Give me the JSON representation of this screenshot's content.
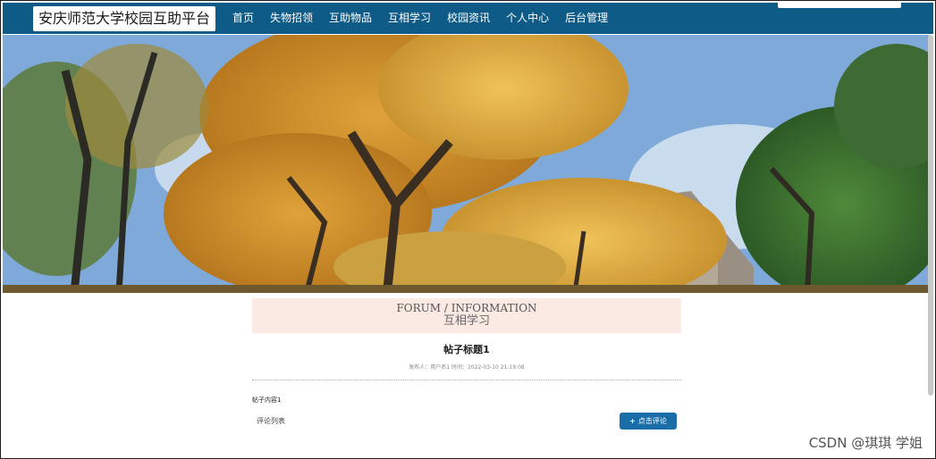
{
  "nav": {
    "brand": "安庆师范大学校园互助平台",
    "items": [
      {
        "label": "首页"
      },
      {
        "label": "失物招领"
      },
      {
        "label": "互助物品"
      },
      {
        "label": "互相学习"
      },
      {
        "label": "校园资讯"
      },
      {
        "label": "个人中心"
      },
      {
        "label": "后台管理"
      }
    ]
  },
  "section": {
    "title_en": "FORUM / INFORMATION",
    "title_cn": "互相学习"
  },
  "post": {
    "title": "帖子标题1",
    "meta": "发布人：用户名1 时间：2022-03-10 21:19:08",
    "content": "帖子内容1"
  },
  "comments": {
    "label": "评论列表",
    "button_label": "点击评论",
    "button_icon": "plus-icon"
  },
  "watermark": "CSDN @琪琪 学姐",
  "colors": {
    "nav_bg": "#0e5b87",
    "accent": "#1a6ea8",
    "section_bg": "#fbe9e3"
  }
}
